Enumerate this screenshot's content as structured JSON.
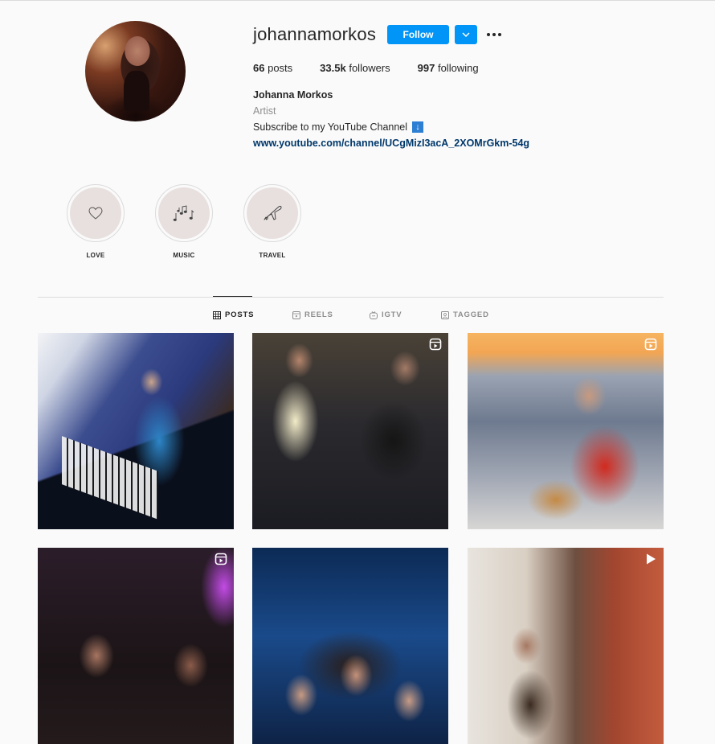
{
  "profile": {
    "username": "johannamorkos",
    "follow_label": "Follow",
    "stats": {
      "posts_count": "66",
      "posts_label": "posts",
      "followers_count": "33.5k",
      "followers_label": "followers",
      "following_count": "997",
      "following_label": "following"
    },
    "full_name": "Johanna Morkos",
    "category": "Artist",
    "bio": "Subscribe to my YouTube Channel",
    "bio_emoji": "↓",
    "link": "www.youtube.com/channel/UCgMizI3acA_2XOMrGkm-54g"
  },
  "highlights": [
    {
      "label": "LOVE",
      "icon": "heart-icon"
    },
    {
      "label": "MUSIC",
      "icon": "music-notes-icon"
    },
    {
      "label": "TRAVEL",
      "icon": "airplane-icon"
    }
  ],
  "tabs": [
    {
      "label": "POSTS",
      "icon": "grid-icon",
      "active": true
    },
    {
      "label": "REELS",
      "icon": "reels-icon",
      "active": false
    },
    {
      "label": "IGTV",
      "icon": "igtv-icon",
      "active": false
    },
    {
      "label": "TAGGED",
      "icon": "tagged-icon",
      "active": false
    }
  ],
  "posts": [
    {
      "badge": "none"
    },
    {
      "badge": "reels-icon"
    },
    {
      "badge": "reels-icon"
    },
    {
      "badge": "reels-icon"
    },
    {
      "badge": "none"
    },
    {
      "badge": "video-icon"
    }
  ],
  "colors": {
    "accent": "#0095f6",
    "link": "#00376b",
    "background": "#fafafa",
    "muted": "#8e8e8e"
  }
}
